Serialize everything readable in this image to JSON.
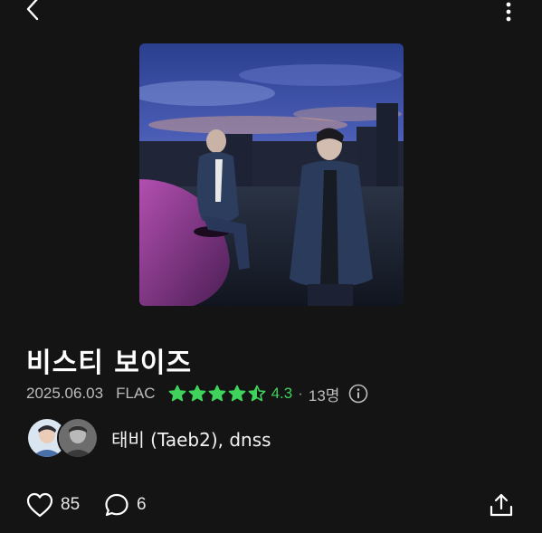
{
  "header": {
    "back_icon": "chevron-left-icon",
    "more_icon": "more-vertical-icon"
  },
  "album": {
    "title": "비스티 보이즈",
    "release_date": "2025.06.03",
    "format": "FLAC",
    "rating": "4.3",
    "rating_value": 4.5,
    "rating_count": "13명",
    "separator": "·"
  },
  "artists": {
    "names": "태비 (Taeb2), dnss"
  },
  "actions": {
    "like_count": "85",
    "comment_count": "6",
    "like_icon": "heart-icon",
    "comment_icon": "comment-icon",
    "share_icon": "share-icon"
  },
  "colors": {
    "background": "#141414",
    "accent_green": "#3fd35c",
    "secondary_text": "#bdbdbd"
  }
}
